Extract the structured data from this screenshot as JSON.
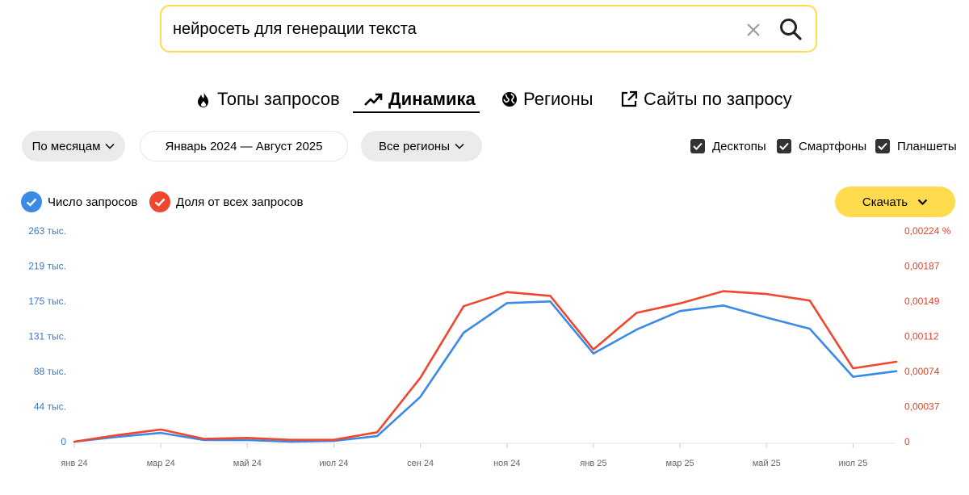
{
  "search": {
    "value": "нейросеть для генерации текста"
  },
  "tabs": [
    {
      "label": "Топы запросов",
      "icon": "fire-icon",
      "active": false
    },
    {
      "label": "Динамика",
      "icon": "trend-up-icon",
      "active": true
    },
    {
      "label": "Регионы",
      "icon": "globe-icon",
      "active": false
    },
    {
      "label": "Сайты по запросу",
      "icon": "external-link-icon",
      "active": false
    }
  ],
  "controls": {
    "period_label": "По месяцам",
    "date_range": "Январь 2024 — Август 2025",
    "regions_label": "Все регионы",
    "devices": [
      {
        "label": "Десктопы",
        "checked": true
      },
      {
        "label": "Смартфоны",
        "checked": true
      },
      {
        "label": "Планшеты",
        "checked": true
      }
    ]
  },
  "legend": {
    "count_label": "Число запросов",
    "share_label": "Доля от всех запросов"
  },
  "download_label": "Скачать",
  "colors": {
    "accent": "#ffdb4d",
    "count_series": "#3a8ae6",
    "share_series": "#f0462d",
    "left_axis_text": "#3a78c9",
    "right_axis_text": "#e0452a"
  },
  "chart_data": {
    "type": "line",
    "x": [
      "янв 24",
      "фев 24",
      "мар 24",
      "апр 24",
      "май 24",
      "июн 24",
      "июл 24",
      "авг 24",
      "сен 24",
      "окт 24",
      "ноя 24",
      "дек 24",
      "янв 25",
      "фев 25",
      "мар 25",
      "апр 25",
      "май 25",
      "июн 25",
      "июл 25",
      "авг 25"
    ],
    "x_tick_labels": [
      "янв 24",
      "мар 24",
      "май 24",
      "июл 24",
      "сен 24",
      "ноя 24",
      "янв 25",
      "мар 25",
      "май 25",
      "июл 25"
    ],
    "series": [
      {
        "name": "Число запросов",
        "axis": "left",
        "values": [
          0,
          6000,
          11000,
          2000,
          2000,
          0,
          1000,
          7000,
          56000,
          136000,
          173000,
          175000,
          110000,
          140000,
          163000,
          170000,
          155000,
          141000,
          81000,
          88000
        ]
      },
      {
        "name": "Доля от всех запросов",
        "axis": "right",
        "values": [
          0.0,
          7e-05,
          0.00013,
          3e-05,
          4e-05,
          2e-05,
          2e-05,
          0.0001,
          0.00068,
          0.00144,
          0.00159,
          0.00155,
          0.00098,
          0.00137,
          0.00147,
          0.0016,
          0.00157,
          0.0015,
          0.00078,
          0.00085
        ]
      }
    ],
    "y_left": {
      "ticks": [
        "0",
        "44 тыс.",
        "88 тыс.",
        "131 тыс.",
        "175 тыс.",
        "219 тыс.",
        "263 тыс."
      ],
      "range": [
        0,
        263000
      ]
    },
    "y_right": {
      "ticks": [
        "0",
        "0,00037",
        "0,00074",
        "0,00112",
        "0,00149",
        "0,00187",
        "0,00224 %"
      ],
      "range": [
        0,
        0.00224
      ]
    },
    "grid": false
  }
}
